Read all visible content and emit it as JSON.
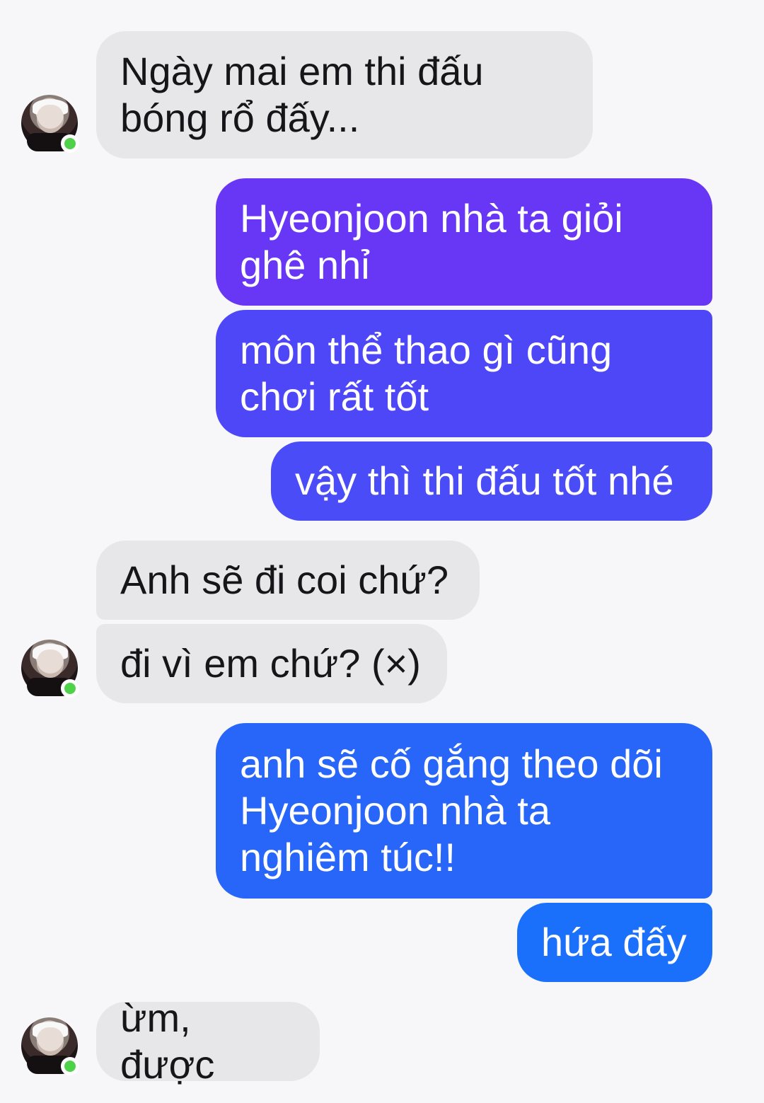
{
  "messages": [
    {
      "id": "m1",
      "from": "them",
      "text": "Ngày mai em thi đấu\nbóng rổ đấy..."
    },
    {
      "id": "m2",
      "from": "me",
      "text": "Hyeonjoon nhà ta giỏi\nghê nhỉ"
    },
    {
      "id": "m3",
      "from": "me",
      "text": "môn thể thao gì cũng\nchơi rất tốt"
    },
    {
      "id": "m4",
      "from": "me",
      "text": "vậy thì thi đấu tốt nhé"
    },
    {
      "id": "m5",
      "from": "them",
      "text": "Anh sẽ đi coi chứ?"
    },
    {
      "id": "m6",
      "from": "them",
      "text": "đi vì em chứ? (×)"
    },
    {
      "id": "m7",
      "from": "me",
      "text": "anh sẽ cố gắng theo dõi\nHyeonjoon nhà ta\nnghiêm túc!!"
    },
    {
      "id": "m8",
      "from": "me",
      "text": "hứa đấy"
    },
    {
      "id": "m9",
      "from": "them",
      "text": "ừm, được"
    }
  ],
  "colors": {
    "incoming_bubble": "#e7e7e9",
    "outgoing_gradient_top": "#6a38f6",
    "outgoing_gradient_bottom": "#1b78fb",
    "online_dot": "#4fd14a",
    "background": "#f7f7f9"
  },
  "avatar": {
    "icon": "user-avatar",
    "status": "online"
  }
}
